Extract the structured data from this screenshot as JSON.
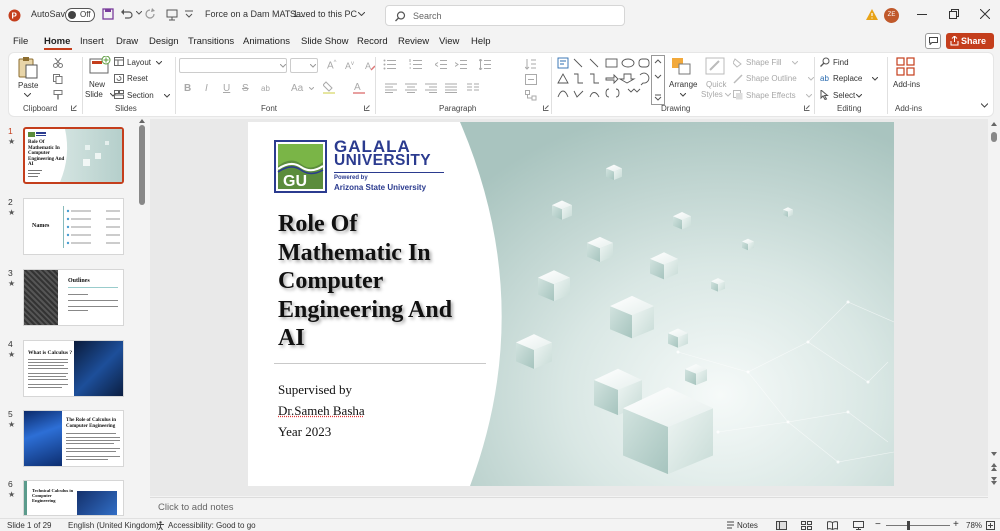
{
  "titlebar": {
    "autosave_label": "AutoSave",
    "autosave_state": "Off",
    "doc_title": "Force on a Dam MAT 1...",
    "save_status": "Saved to this PC",
    "search_placeholder": "Search",
    "user_initials": "ZE"
  },
  "tabs": [
    "File",
    "Home",
    "Insert",
    "Draw",
    "Design",
    "Transitions",
    "Animations",
    "Slide Show",
    "Record",
    "Review",
    "View",
    "Help"
  ],
  "share_label": "Share",
  "ribbon": {
    "clipboard": {
      "paste": "Paste",
      "group": "Clipboard"
    },
    "slides": {
      "new_slide_1": "New",
      "new_slide_2": "Slide",
      "layout": "Layout",
      "reset": "Reset",
      "section": "Section",
      "group": "Slides"
    },
    "font": {
      "group": "Font",
      "bold": "B",
      "italic": "I",
      "underline": "U",
      "strike": "S",
      "spacing": "ab",
      "case": "Aa"
    },
    "paragraph": {
      "group": "Paragraph"
    },
    "drawing": {
      "arrange": "Arrange",
      "quick_1": "Quick",
      "quick_2": "Styles",
      "shape_fill": "Shape Fill",
      "shape_outline": "Shape Outline",
      "shape_effects": "Shape Effects",
      "group": "Drawing"
    },
    "editing": {
      "find": "Find",
      "replace": "Replace",
      "select": "Select",
      "group": "Editing"
    },
    "addins": {
      "label": "Add-ins",
      "group": "Add-ins"
    }
  },
  "thumbnails": [
    {
      "num": "1",
      "star": "★",
      "title": "Role Of Mathematic In Computer Engineering And AI"
    },
    {
      "num": "2",
      "star": "★",
      "title": "Names"
    },
    {
      "num": "3",
      "star": "★",
      "title": "Outlines"
    },
    {
      "num": "4",
      "star": "★",
      "title": "What is Calculus ?"
    },
    {
      "num": "5",
      "star": "★",
      "title": "The Role of Calculus in Computer Engineering"
    },
    {
      "num": "6",
      "star": "★",
      "title": "Technical Calculus in Computer Engineering"
    }
  ],
  "slide": {
    "logo_top": "GALALA",
    "logo_bottom": "UNIVERSITY",
    "logo_powered": "Powered by",
    "logo_asu": "Arizona State University",
    "logo_mark": "GU",
    "title": [
      "Role Of",
      "Mathematic In",
      "Computer",
      "Engineering And",
      "AI"
    ],
    "supervised": "Supervised by",
    "supervisor": "Dr.Sameh Basha",
    "year": "Year 2023"
  },
  "notes_placeholder": "Click to add notes",
  "status": {
    "slide_of": "Slide 1 of 29",
    "language": "English (United Kingdom)",
    "accessibility": "Accessibility: Good to go",
    "notes": "Notes",
    "zoom": "78%"
  },
  "colors": {
    "accent": "#c43e1c",
    "logo_blue": "#2b3b8f",
    "logo_green": "#7ab547"
  }
}
